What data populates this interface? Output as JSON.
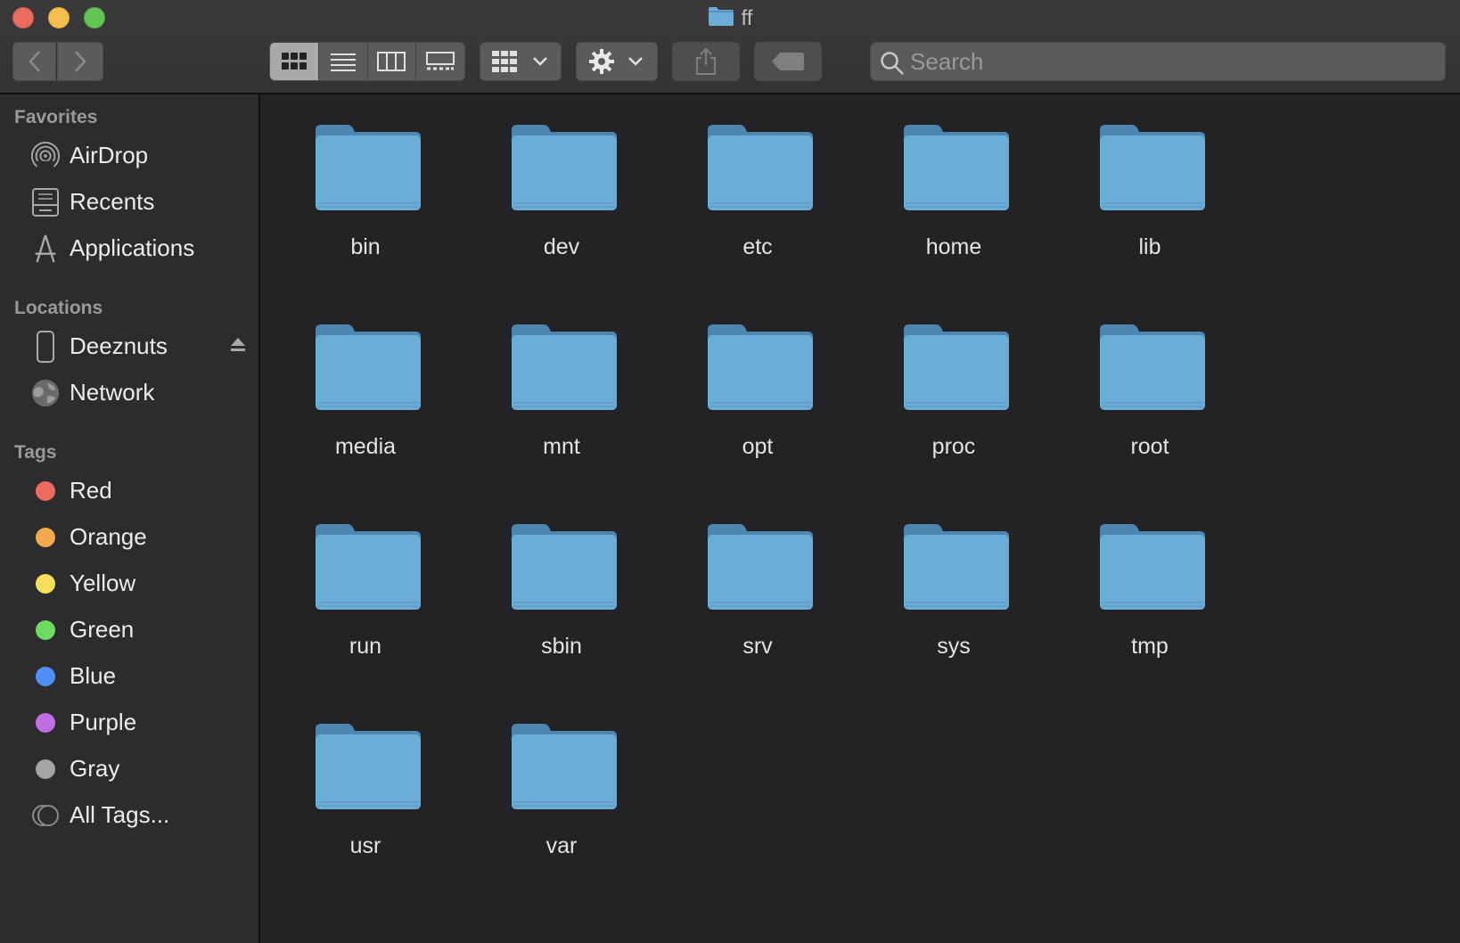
{
  "window": {
    "title": "ff"
  },
  "toolbar": {
    "back_icon": "chevron-left-icon",
    "forward_icon": "chevron-right-icon",
    "view_modes": [
      "icon-view",
      "list-view",
      "column-view",
      "gallery-view"
    ],
    "active_view": "icon-view",
    "search_placeholder": "Search"
  },
  "sidebar": {
    "favorites_header": "Favorites",
    "favorites": [
      {
        "label": "AirDrop",
        "icon": "airdrop-icon"
      },
      {
        "label": "Recents",
        "icon": "recents-icon"
      },
      {
        "label": "Applications",
        "icon": "applications-icon"
      }
    ],
    "locations_header": "Locations",
    "locations": [
      {
        "label": "Deeznuts",
        "icon": "phone-icon",
        "ejectable": true
      },
      {
        "label": "Network",
        "icon": "network-globe-icon"
      }
    ],
    "tags_header": "Tags",
    "tags": [
      {
        "label": "Red",
        "color": "#ec6a5e"
      },
      {
        "label": "Orange",
        "color": "#f3a94c"
      },
      {
        "label": "Yellow",
        "color": "#f6e05a"
      },
      {
        "label": "Green",
        "color": "#6bdc5f"
      },
      {
        "label": "Blue",
        "color": "#4f8ef7"
      },
      {
        "label": "Purple",
        "color": "#c16ee5"
      },
      {
        "label": "Gray",
        "color": "#a5a5a7"
      },
      {
        "label": "All Tags...",
        "color": ""
      }
    ]
  },
  "content": {
    "folders": [
      "bin",
      "dev",
      "etc",
      "home",
      "lib",
      "media",
      "mnt",
      "opt",
      "proc",
      "root",
      "run",
      "sbin",
      "srv",
      "sys",
      "tmp",
      "usr",
      "var"
    ]
  },
  "colors": {
    "folder_body": "#6aaed8",
    "folder_tab": "#4e86b2",
    "background": "#232325",
    "sidebar": "#2c2c2e"
  }
}
